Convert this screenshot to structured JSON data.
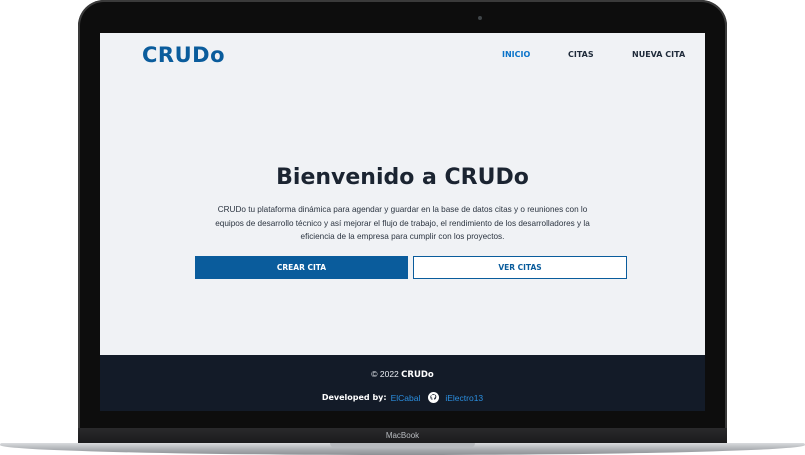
{
  "device": {
    "brand_label": "MacBook"
  },
  "site": {
    "logo": "CRUDo",
    "nav": [
      {
        "label": "INICIO",
        "active": true
      },
      {
        "label": "CITAS",
        "active": false
      },
      {
        "label": "NUEVA CITA",
        "active": false
      }
    ],
    "hero": {
      "title": "Bienvenido a CRUDo",
      "description_lines": [
        "CRUDo tu plataforma dinámica para agendar y guardar en la base de datos citas y o reuniones con lo",
        "equipos de desarrollo técnico y así mejorar el flujo de trabajo, el rendimiento de los desarrolladores y la",
        "eficiencia de la empresa para cumplir con los proyectos."
      ],
      "primary_button": "CREAR CITA",
      "secondary_button": "VER CITAS"
    },
    "footer": {
      "copyright_prefix": "© 2022",
      "copyright_brand": "CRUDo",
      "developed_by_label": "Developed by:",
      "developer_1": "ElCabal",
      "developer_2": "iElectro13",
      "github_icon": "github-icon"
    }
  },
  "colors": {
    "brand_blue": "#0a5c9c",
    "active_link": "#0a73c9",
    "footer_bg": "#131b28",
    "page_bg": "#f0f2f5",
    "link_blue": "#2b8fe0"
  }
}
